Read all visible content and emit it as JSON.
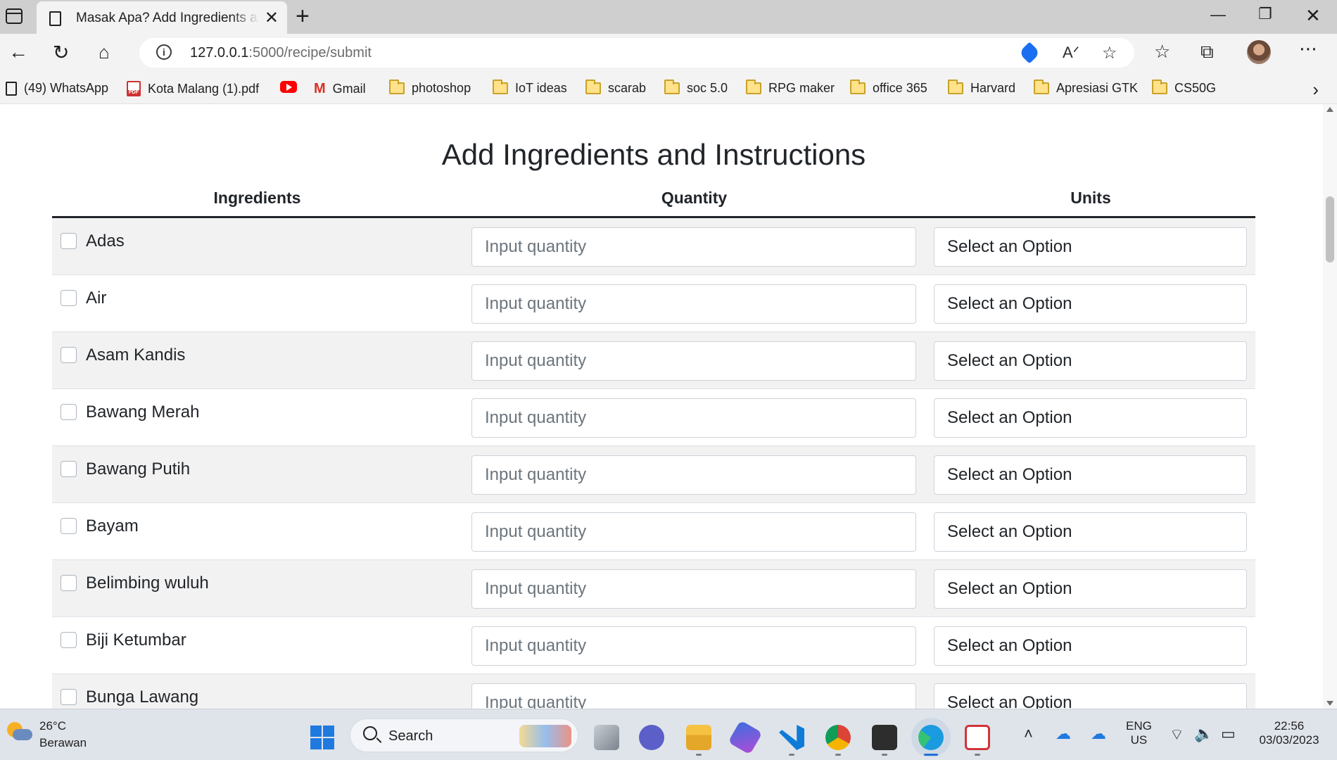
{
  "browser": {
    "tab_title": "Masak Apa? Add Ingredients and Instructions",
    "tab_close": "✕",
    "new_tab": "+",
    "url_host": "127.0.0.1",
    "url_path": ":5000/recipe/submit",
    "bookmarks": [
      {
        "label": "(49) WhatsApp",
        "icon": "page-icon"
      },
      {
        "label": "Kota Malang (1).pdf",
        "icon": "pdf-icon"
      },
      {
        "label": "",
        "icon": "youtube-icon"
      },
      {
        "label": "Gmail",
        "icon": "gmail-icon"
      },
      {
        "label": "photoshop",
        "icon": "folder-icon"
      },
      {
        "label": "IoT ideas",
        "icon": "folder-icon"
      },
      {
        "label": "scarab",
        "icon": "folder-icon"
      },
      {
        "label": "soc 5.0",
        "icon": "folder-icon"
      },
      {
        "label": "RPG maker",
        "icon": "folder-icon"
      },
      {
        "label": "office 365",
        "icon": "folder-icon"
      },
      {
        "label": "Harvard",
        "icon": "folder-icon"
      },
      {
        "label": "Apresiasi GTK",
        "icon": "folder-icon"
      },
      {
        "label": "CS50G",
        "icon": "folder-icon"
      }
    ]
  },
  "page": {
    "title": "Add Ingredients and Instructions",
    "columns": {
      "ingredients": "Ingredients",
      "quantity": "Quantity",
      "units": "Units"
    },
    "quantity_placeholder": "Input quantity",
    "unit_default": "Select an Option",
    "ingredients": [
      "Adas",
      "Air",
      "Asam Kandis",
      "Bawang Merah",
      "Bawang Putih",
      "Bayam",
      "Belimbing wuluh",
      "Biji Ketumbar",
      "Bunga Lawang"
    ]
  },
  "taskbar": {
    "temperature": "26°C",
    "weather": "Berawan",
    "search_label": "Search",
    "lang_top": "ENG",
    "lang_bottom": "US",
    "time": "22:56",
    "date": "03/03/2023"
  },
  "colors": {
    "accent": "#1f6fd6",
    "row_stripe": "#f2f2f2",
    "header_rule": "#212529"
  }
}
